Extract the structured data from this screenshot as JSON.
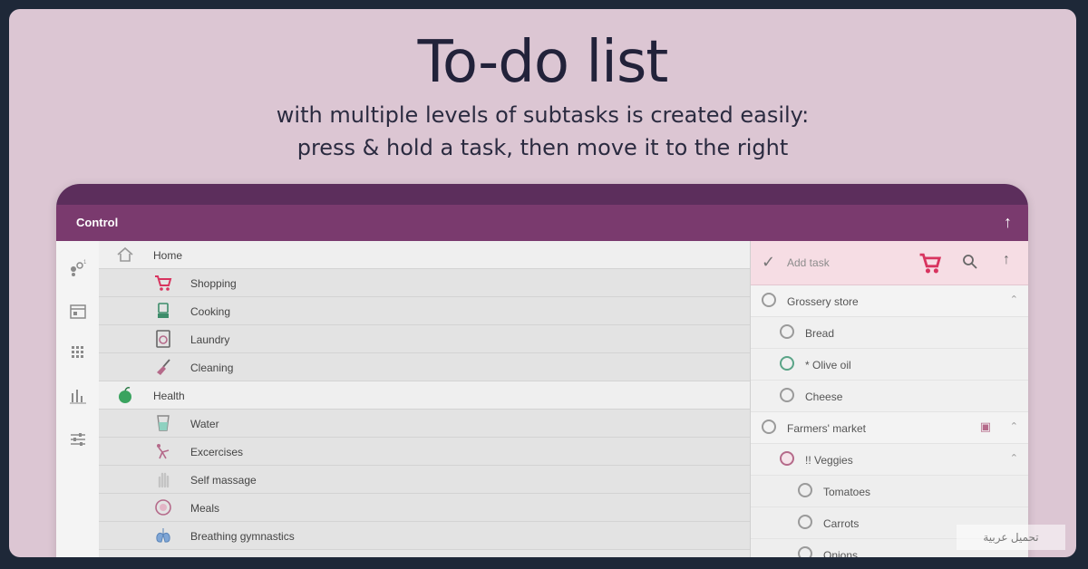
{
  "headline": "To-do list",
  "subheadline": {
    "line1": "with multiple levels of subtasks is created easily:",
    "line2": "press & hold a task, then move it to the right"
  },
  "appbar": {
    "title": "Control",
    "action_icon": "up-arrow-icon"
  },
  "rail_icons": [
    "settings-dots-icon",
    "calendar-icon",
    "grid-icon",
    "bar-chart-icon",
    "sliders-icon"
  ],
  "categories": [
    {
      "label": "Home",
      "icon": "home-icon",
      "type": "group"
    },
    {
      "label": "Shopping",
      "icon": "cart-icon",
      "type": "child"
    },
    {
      "label": "Cooking",
      "icon": "blender-icon",
      "type": "child"
    },
    {
      "label": "Laundry",
      "icon": "washing-machine-icon",
      "type": "child"
    },
    {
      "label": "Cleaning",
      "icon": "broom-icon",
      "type": "child"
    },
    {
      "label": "Health",
      "icon": "apple-icon",
      "type": "group"
    },
    {
      "label": "Water",
      "icon": "glass-icon",
      "type": "child"
    },
    {
      "label": "Excercises",
      "icon": "exercise-icon",
      "type": "child"
    },
    {
      "label": "Self massage",
      "icon": "hand-icon",
      "type": "child"
    },
    {
      "label": "Meals",
      "icon": "meal-icon",
      "type": "child"
    },
    {
      "label": "Breathing gymnastics",
      "icon": "lungs-icon",
      "type": "child"
    }
  ],
  "task_panel": {
    "add_placeholder": "Add task",
    "tasks": [
      {
        "label": "Grossery store",
        "level": 0
      },
      {
        "label": "Bread",
        "level": 1
      },
      {
        "label": "* Olive oil",
        "level": 1
      },
      {
        "label": "Cheese",
        "level": 1
      },
      {
        "label": "Farmers' market",
        "level": 0
      },
      {
        "label": "!! Veggies",
        "level": 1
      },
      {
        "label": "Tomatoes",
        "level": 2
      },
      {
        "label": "Carrots",
        "level": 2
      },
      {
        "label": "Onions",
        "level": 2
      }
    ]
  },
  "watermark": "تحميل عربية",
  "colors": {
    "background": "#dcc6d3",
    "appbar": "#7a3a6e",
    "tablet_top": "#5c2e5c",
    "cart_accent": "#d8345f",
    "task_bar": "#f6dde4"
  }
}
